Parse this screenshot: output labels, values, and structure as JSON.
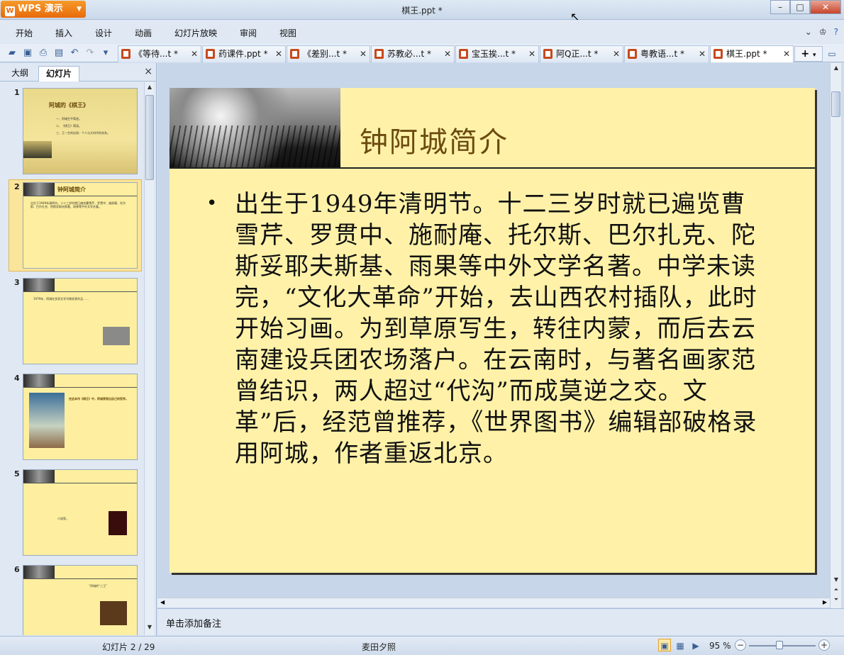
{
  "app": {
    "logo_label": "WPS 演示",
    "window_title": "棋王.ppt *"
  },
  "window_controls": {
    "minimize": "–",
    "maximize": "□",
    "close": "✕"
  },
  "menu": {
    "items": [
      "开始",
      "插入",
      "设计",
      "动画",
      "幻灯片放映",
      "审阅",
      "视图"
    ]
  },
  "doc_tabs": [
    {
      "label": "《等待...t *",
      "active": false
    },
    {
      "label": "药课件.ppt *",
      "active": false
    },
    {
      "label": "《差别...t *",
      "active": false
    },
    {
      "label": "苏教必...t *",
      "active": false
    },
    {
      "label": "宝玉挨...t *",
      "active": false
    },
    {
      "label": "阿Q正...t *",
      "active": false
    },
    {
      "label": "粤教语...t *",
      "active": false
    },
    {
      "label": "棋王.ppt *",
      "active": true
    }
  ],
  "left_panel": {
    "tab_outline": "大纲",
    "tab_slides": "幻灯片",
    "close": "×",
    "thumbnails": [
      {
        "num": "1",
        "title": "阿城的《棋王》",
        "lines": [
          "一、阿城生平简述。",
          "二、《棋王》简读。",
          "三、王一生的出场：个人与大时代的关系。"
        ]
      },
      {
        "num": "2",
        "title": "钟阿城简介",
        "lines": [
          "出生于1949年清明节。十二三岁时就已遍览曹雪芹、罗贯中、施耐庵、托尔斯、巴尔扎克、陀斯妥耶夫斯基、雨果等中外文学名著。"
        ]
      },
      {
        "num": "3",
        "title": "",
        "lines": [
          "1979年，阿城在多家文学刊物发表作品……"
        ]
      },
      {
        "num": "4",
        "title": "",
        "lines": [
          "在这本作《棋王》中，阿城表现出自己的哲学。"
        ]
      },
      {
        "num": "5",
        "title": "",
        "lines": [
          "小说家。"
        ]
      },
      {
        "num": "6",
        "title": "",
        "lines": [
          "“阿城的“三王”"
        ]
      }
    ]
  },
  "slide": {
    "title": "钟阿城简介",
    "body": "出生于1949年清明节。十二三岁时就已遍览曹雪芹、罗贯中、施耐庵、托尔斯、巴尔扎克、陀斯妥耶夫斯基、雨果等中外文学名著。中学未读完，“文化大革命”开始，去山西农村插队，此时开始习画。为到草原写生，转往内蒙，而后去云南建设兵团农场落户。在云南时，与著名画家范曾结识，两人超过“代沟”而成莫逆之交。文革”后，经范曾推荐，《世界图书》编辑部破格录用阿城，作者重返北京。",
    "bullet": "•"
  },
  "notes": {
    "placeholder": "单击添加备注"
  },
  "status": {
    "slide_counter": "幻灯片 2 / 29",
    "theme": "麦田夕照",
    "zoom": "95 %"
  }
}
